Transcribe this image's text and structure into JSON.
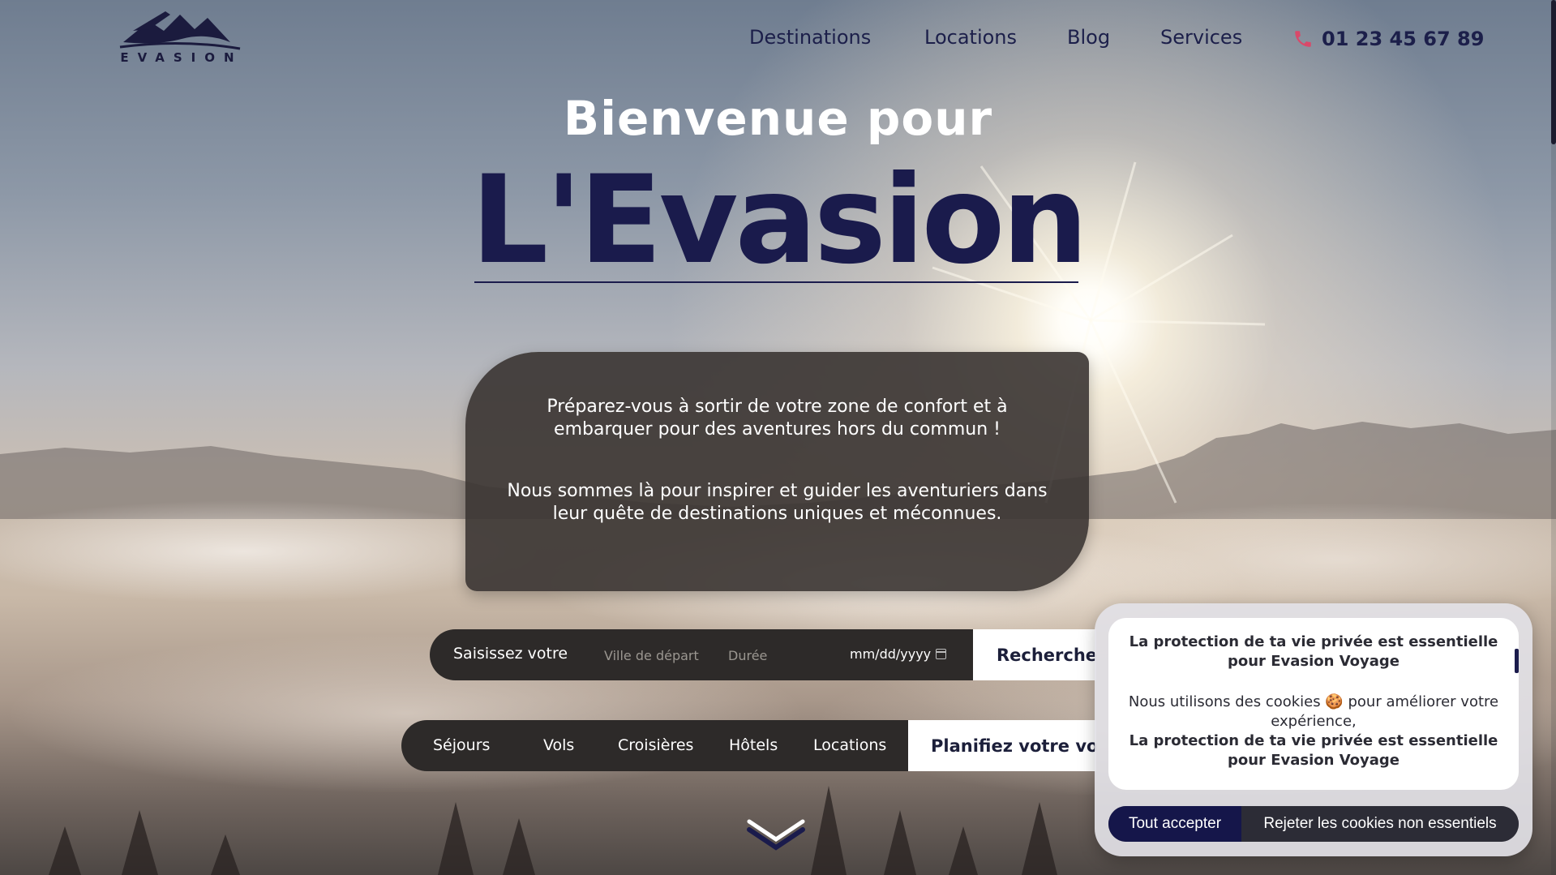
{
  "header": {
    "logo_text": "EVASION",
    "nav": [
      {
        "label": "Destinations"
      },
      {
        "label": "Locations"
      },
      {
        "label": "Blog"
      },
      {
        "label": "Services"
      }
    ],
    "phone": {
      "icon": "phone-icon",
      "number": "01 23 45 67 89"
    }
  },
  "hero": {
    "line1": "Bienvenue pour",
    "line2": "L'Evasion",
    "paragraphs": [
      "Préparez-vous à sortir de votre zone de confort et à embarquer pour des aventures hors du commun !",
      "Nous sommes là pour inspirer et guider les aventuriers dans leur quête de destinations uniques et méconnues."
    ]
  },
  "search": {
    "label": "Saisissez votre",
    "departure_placeholder": "Ville de départ",
    "duration_placeholder": "Durée",
    "date_value": "mm/dd/yyyy",
    "button_label": "Recherche"
  },
  "categories": {
    "items": [
      {
        "label": "Séjours"
      },
      {
        "label": "Vols"
      },
      {
        "label": "Croisières"
      },
      {
        "label": "Hôtels"
      },
      {
        "label": "Locations"
      }
    ],
    "plan_label": "Planifiez votre voy"
  },
  "cookie_banner": {
    "title": "La protection de ta vie privée est essentielle pour Evasion Voyage",
    "body": "Nous utilisons des cookies 🍪 pour améliorer votre expérience,",
    "title_repeat": "La protection de ta vie privée est essentielle pour Evasion Voyage",
    "accept_label": "Tout accepter",
    "reject_label": "Rejeter les cookies non essentiels"
  },
  "colors": {
    "brand_navy": "#1a1b4c",
    "card_dark": "#2d2a29",
    "phone_icon": "#d9496a"
  }
}
